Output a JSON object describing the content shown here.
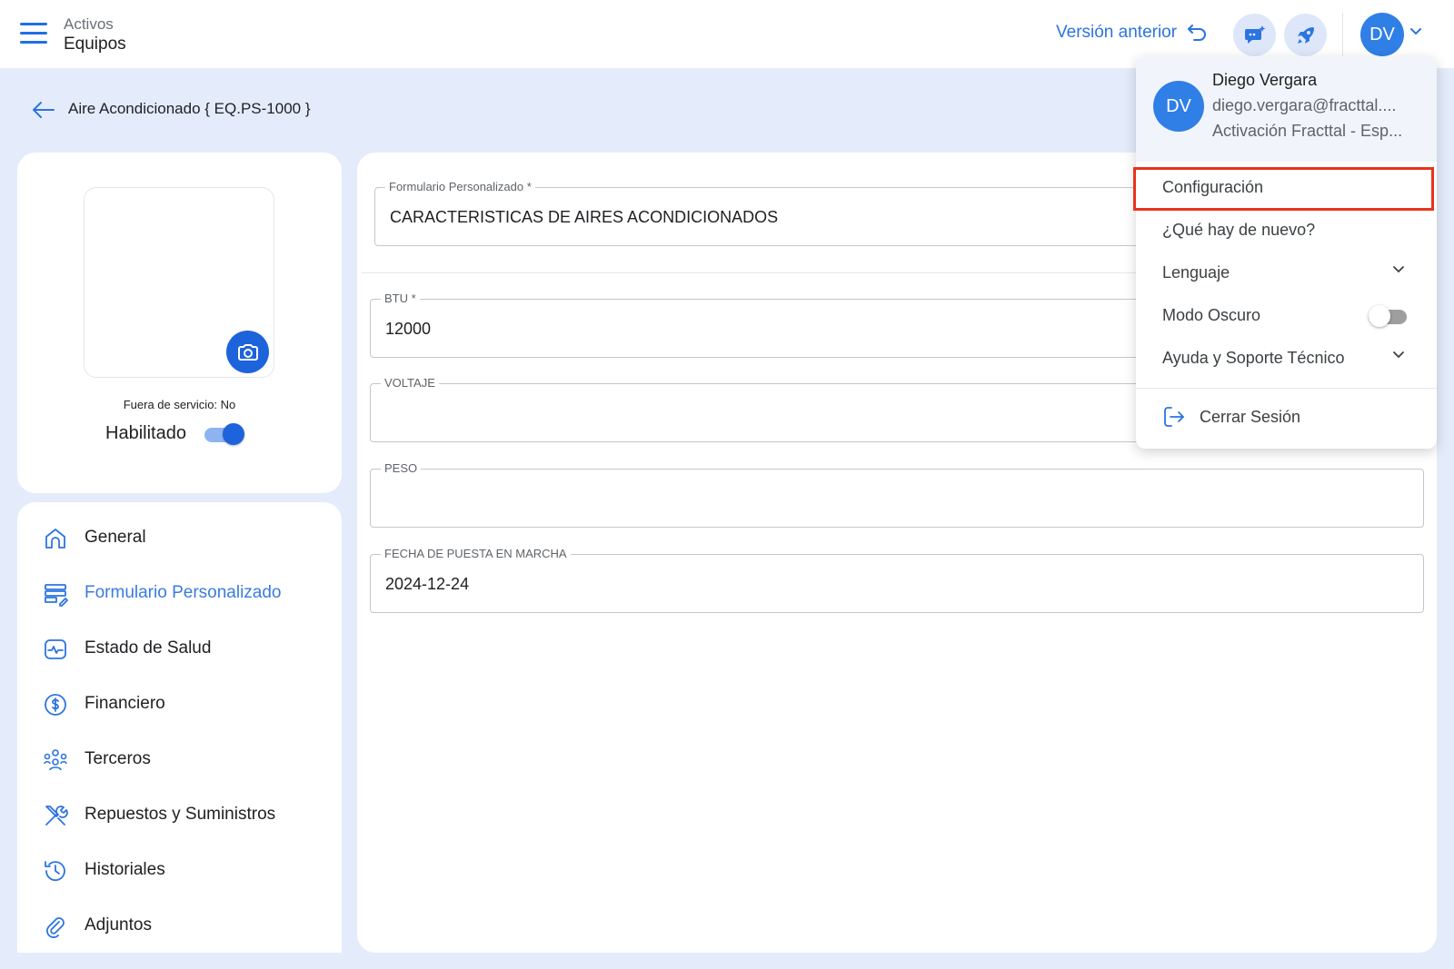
{
  "header": {
    "section": "Activos",
    "subsection": "Equipos",
    "prev_version_label": "Versión anterior",
    "avatar_initials": "DV"
  },
  "page": {
    "title": "Aire Acondicionado { EQ.PS-1000 }"
  },
  "asset_card": {
    "out_of_service_text": "Fuera de servicio: No",
    "enabled_label": "Habilitado",
    "enabled": true
  },
  "nav": {
    "items": [
      {
        "label": "General",
        "icon": "home-icon",
        "active": false
      },
      {
        "label": "Formulario Personalizado",
        "icon": "form-icon",
        "active": true
      },
      {
        "label": "Estado de Salud",
        "icon": "health-icon",
        "active": false
      },
      {
        "label": "Financiero",
        "icon": "dollar-icon",
        "active": false
      },
      {
        "label": "Terceros",
        "icon": "people-icon",
        "active": false
      },
      {
        "label": "Repuestos y Suministros",
        "icon": "tools-icon",
        "active": false
      },
      {
        "label": "Historiales",
        "icon": "history-icon",
        "active": false
      },
      {
        "label": "Adjuntos",
        "icon": "paperclip-icon",
        "active": false
      }
    ]
  },
  "form": {
    "custom_form_label": "Formulario Personalizado *",
    "custom_form_value": "CARACTERISTICAS DE AIRES ACONDICIONADOS",
    "btu_label": "BTU *",
    "btu_value": "12000",
    "voltage_label": "VOLTAJE",
    "voltage_value": "",
    "weight_label": "PESO",
    "weight_value": "",
    "start_date_label": "FECHA DE PUESTA EN MARCHA",
    "start_date_value": "2024-12-24"
  },
  "user_menu": {
    "initials": "DV",
    "name": "Diego Vergara",
    "email": "diego.vergara@fracttal....",
    "org": "Activación Fracttal - Esp...",
    "items": {
      "settings": "Configuración",
      "whats_new": "¿Qué hay de nuevo?",
      "language": "Lenguaje",
      "dark_mode": "Modo Oscuro",
      "help": "Ayuda y Soporte Técnico",
      "logout": "Cerrar Sesión"
    },
    "dark_mode_enabled": false
  },
  "colors": {
    "accent": "#1d63db",
    "link": "#2c74e0",
    "background": "#e4ecfb",
    "highlight": "#e8341c"
  }
}
